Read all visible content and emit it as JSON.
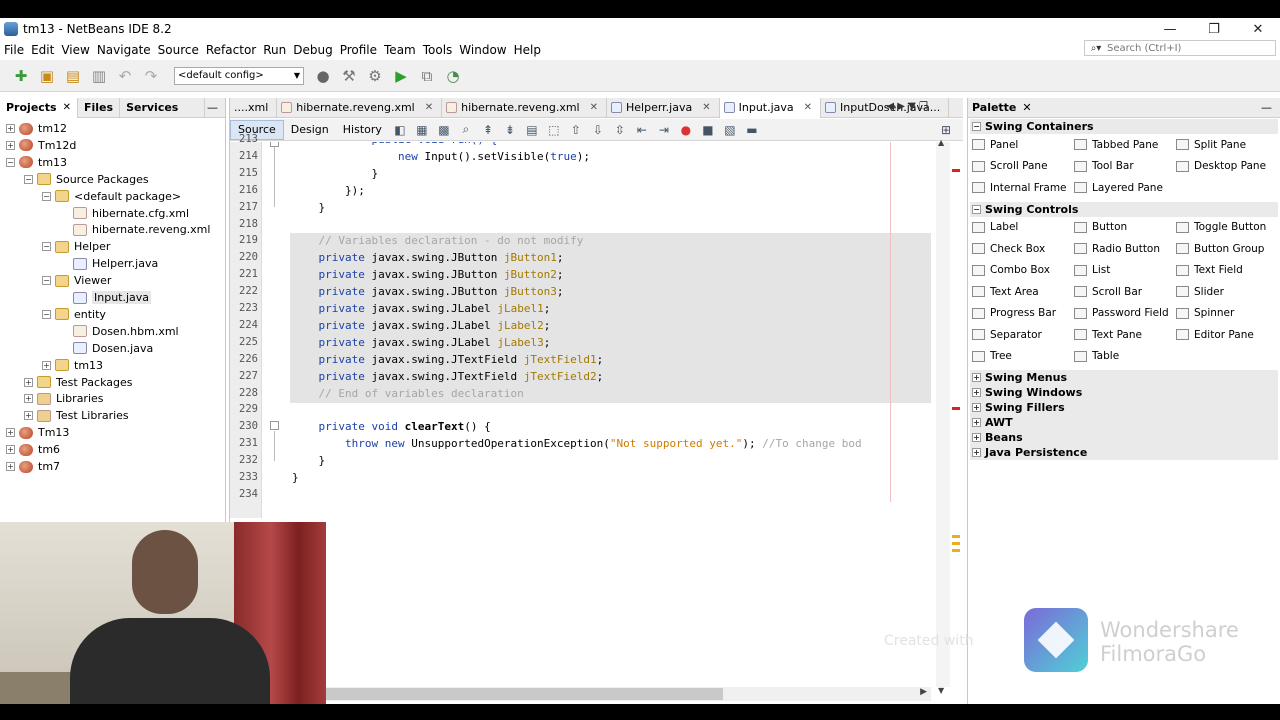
{
  "window": {
    "title": "tm13 - NetBeans IDE 8.2",
    "minimize": "—",
    "maximize": "❐",
    "close": "✕"
  },
  "menu": [
    "File",
    "Edit",
    "View",
    "Navigate",
    "Source",
    "Refactor",
    "Run",
    "Debug",
    "Profile",
    "Team",
    "Tools",
    "Window",
    "Help"
  ],
  "search": {
    "placeholder": "Search (Ctrl+I)"
  },
  "toolbar": {
    "config": "<default config>"
  },
  "left_panel": {
    "tabs": [
      "Projects",
      "Files",
      "Services"
    ],
    "tree": [
      {
        "label": "tm12",
        "level": 0,
        "toggle": "+",
        "icon": "proj"
      },
      {
        "label": "Tm12d",
        "level": 0,
        "toggle": "+",
        "icon": "proj"
      },
      {
        "label": "tm13",
        "level": 0,
        "toggle": "−",
        "icon": "proj"
      },
      {
        "label": "Source Packages",
        "level": 1,
        "toggle": "−",
        "icon": "pkg"
      },
      {
        "label": "<default package>",
        "level": 2,
        "toggle": "−",
        "icon": "pkg"
      },
      {
        "label": "hibernate.cfg.xml",
        "level": 3,
        "toggle": "",
        "icon": "xml"
      },
      {
        "label": "hibernate.reveng.xml",
        "level": 3,
        "toggle": "",
        "icon": "xml"
      },
      {
        "label": "Helper",
        "level": 2,
        "toggle": "−",
        "icon": "pkg"
      },
      {
        "label": "Helperr.java",
        "level": 3,
        "toggle": "",
        "icon": "java"
      },
      {
        "label": "Viewer",
        "level": 2,
        "toggle": "−",
        "icon": "pkg"
      },
      {
        "label": "Input.java",
        "level": 3,
        "toggle": "",
        "icon": "java",
        "selected": true
      },
      {
        "label": "entity",
        "level": 2,
        "toggle": "−",
        "icon": "pkg"
      },
      {
        "label": "Dosen.hbm.xml",
        "level": 3,
        "toggle": "",
        "icon": "xml"
      },
      {
        "label": "Dosen.java",
        "level": 3,
        "toggle": "",
        "icon": "java"
      },
      {
        "label": "tm13",
        "level": 2,
        "toggle": "+",
        "icon": "pkg"
      },
      {
        "label": "Test Packages",
        "level": 1,
        "toggle": "+",
        "icon": "pkg"
      },
      {
        "label": "Libraries",
        "level": 1,
        "toggle": "+",
        "icon": "lib"
      },
      {
        "label": "Test Libraries",
        "level": 1,
        "toggle": "+",
        "icon": "lib"
      },
      {
        "label": "Tm13",
        "level": 0,
        "toggle": "+",
        "icon": "proj"
      },
      {
        "label": "tm6",
        "level": 0,
        "toggle": "+",
        "icon": "proj"
      },
      {
        "label": "tm7",
        "level": 0,
        "toggle": "+",
        "icon": "proj"
      }
    ]
  },
  "editor": {
    "tabs": [
      {
        "label": "....xml",
        "active": false,
        "close": false
      },
      {
        "label": "hibernate.reveng.xml",
        "active": false,
        "close": true
      },
      {
        "label": "hibernate.reveng.xml",
        "active": false,
        "close": true
      },
      {
        "label": "Helperr.java",
        "active": false,
        "close": true
      },
      {
        "label": "Input.java",
        "active": true,
        "close": true
      },
      {
        "label": "InputDosen.java...",
        "active": false,
        "close": false
      }
    ],
    "views": [
      "Source",
      "Design",
      "History"
    ],
    "lines": [
      {
        "n": "213",
        "parts": [
          [
            "kw",
            "            public void run() {"
          ]
        ]
      },
      {
        "n": "214",
        "parts": [
          [
            "kw",
            "                new "
          ],
          [
            "plain",
            "Input().setVisible("
          ],
          [
            "kw",
            "true"
          ],
          [
            "plain",
            ");"
          ]
        ]
      },
      {
        "n": "215",
        "parts": [
          [
            "plain",
            "            }"
          ]
        ]
      },
      {
        "n": "216",
        "parts": [
          [
            "plain",
            "        });"
          ]
        ]
      },
      {
        "n": "217",
        "parts": [
          [
            "plain",
            "    }"
          ]
        ]
      },
      {
        "n": "218",
        "parts": [
          [
            "plain",
            ""
          ]
        ]
      },
      {
        "n": "219",
        "parts": [
          [
            "cm",
            "    // Variables declaration - do not modify"
          ]
        ]
      },
      {
        "n": "220",
        "parts": [
          [
            "kw",
            "    private "
          ],
          [
            "plain",
            "javax.swing.JButton "
          ],
          [
            "var",
            "jButton1"
          ],
          [
            "plain",
            ";"
          ]
        ]
      },
      {
        "n": "221",
        "parts": [
          [
            "kw",
            "    private "
          ],
          [
            "plain",
            "javax.swing.JButton "
          ],
          [
            "var",
            "jButton2"
          ],
          [
            "plain",
            ";"
          ]
        ]
      },
      {
        "n": "222",
        "parts": [
          [
            "kw",
            "    private "
          ],
          [
            "plain",
            "javax.swing.JButton "
          ],
          [
            "var",
            "jButton3"
          ],
          [
            "plain",
            ";"
          ]
        ]
      },
      {
        "n": "223",
        "parts": [
          [
            "kw",
            "    private "
          ],
          [
            "plain",
            "javax.swing.JLabel "
          ],
          [
            "var",
            "jLabel1"
          ],
          [
            "plain",
            ";"
          ]
        ]
      },
      {
        "n": "224",
        "parts": [
          [
            "kw",
            "    private "
          ],
          [
            "plain",
            "javax.swing.JLabel "
          ],
          [
            "var",
            "jLabel2"
          ],
          [
            "plain",
            ";"
          ]
        ]
      },
      {
        "n": "225",
        "parts": [
          [
            "kw",
            "    private "
          ],
          [
            "plain",
            "javax.swing.JLabel "
          ],
          [
            "var",
            "jLabel3"
          ],
          [
            "plain",
            ";"
          ]
        ]
      },
      {
        "n": "226",
        "parts": [
          [
            "kw",
            "    private "
          ],
          [
            "plain",
            "javax.swing.JTextField "
          ],
          [
            "var",
            "jTextField1"
          ],
          [
            "plain",
            ";"
          ]
        ]
      },
      {
        "n": "227",
        "parts": [
          [
            "kw",
            "    private "
          ],
          [
            "plain",
            "javax.swing.JTextField "
          ],
          [
            "var",
            "jTextField2"
          ],
          [
            "plain",
            ";"
          ]
        ]
      },
      {
        "n": "228",
        "parts": [
          [
            "cm",
            "    // End of variables declaration"
          ]
        ]
      },
      {
        "n": "229",
        "parts": [
          [
            "plain",
            ""
          ]
        ]
      },
      {
        "n": "230",
        "parts": [
          [
            "kw",
            "    private void "
          ],
          [
            "mname",
            "clearText"
          ],
          [
            "plain",
            "() {"
          ]
        ]
      },
      {
        "n": "231",
        "parts": [
          [
            "kw",
            "        throw new "
          ],
          [
            "plain",
            "UnsupportedOperationException("
          ],
          [
            "str",
            "\"Not supported yet.\""
          ],
          [
            "plain",
            "); "
          ],
          [
            "cm",
            "//To change bod"
          ]
        ]
      },
      {
        "n": "232",
        "parts": [
          [
            "plain",
            "    }"
          ]
        ]
      },
      {
        "n": "233",
        "parts": [
          [
            "plain",
            "}"
          ]
        ]
      },
      {
        "n": "234",
        "parts": [
          [
            "plain",
            ""
          ]
        ]
      }
    ]
  },
  "palette": {
    "title": "Palette",
    "categories": [
      {
        "name": "Swing Containers",
        "open": true,
        "items": [
          "Panel",
          "Tabbed Pane",
          "Split Pane",
          "Scroll Pane",
          "Tool Bar",
          "Desktop Pane",
          "Internal Frame",
          "Layered Pane"
        ]
      },
      {
        "name": "Swing Controls",
        "open": true,
        "items": [
          "Label",
          "Button",
          "Toggle Button",
          "Check Box",
          "Radio Button",
          "Button Group",
          "Combo Box",
          "List",
          "Text Field",
          "Text Area",
          "Scroll Bar",
          "Slider",
          "Progress Bar",
          "Password Field",
          "Spinner",
          "Separator",
          "Text Pane",
          "Editor Pane",
          "Tree",
          "Table"
        ]
      },
      {
        "name": "Swing Menus",
        "open": false,
        "items": []
      },
      {
        "name": "Swing Windows",
        "open": false,
        "items": []
      },
      {
        "name": "Swing Fillers",
        "open": false,
        "items": []
      },
      {
        "name": "AWT",
        "open": false,
        "items": []
      },
      {
        "name": "Beans",
        "open": false,
        "items": []
      },
      {
        "name": "Java Persistence",
        "open": false,
        "items": []
      }
    ]
  },
  "watermark": {
    "created": "Created with",
    "brand_line1": "Wondershare",
    "brand_line2": "FilmoraGo"
  }
}
